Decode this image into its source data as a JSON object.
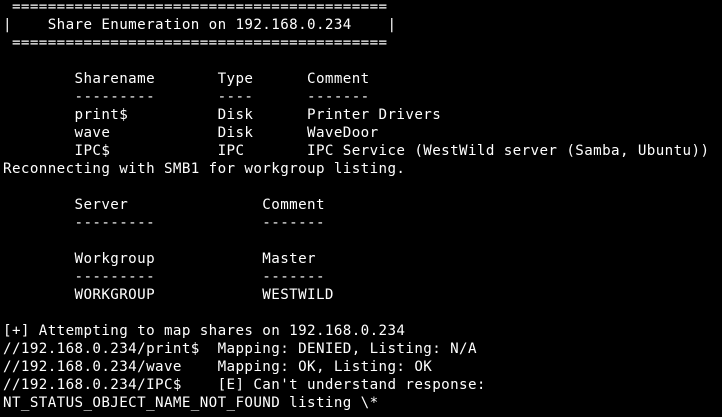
{
  "terminal": {
    "colors": {
      "background": "#000000",
      "foreground": "#ffffff"
    },
    "lines": [
      " ==========================================",
      "|    Share Enumeration on 192.168.0.234    |",
      " ==========================================",
      "",
      "        Sharename       Type      Comment",
      "        ---------       ----      -------",
      "        print$          Disk      Printer Drivers",
      "        wave            Disk      WaveDoor",
      "        IPC$            IPC       IPC Service (WestWild server (Samba, Ubuntu))",
      "Reconnecting with SMB1 for workgroup listing.",
      "",
      "        Server               Comment",
      "        ---------            -------",
      "",
      "        Workgroup            Master",
      "        ---------            -------",
      "        WORKGROUP            WESTWILD",
      "",
      "[+] Attempting to map shares on 192.168.0.234",
      "//192.168.0.234/print$  Mapping: DENIED, Listing: N/A",
      "//192.168.0.234/wave    Mapping: OK, Listing: OK",
      "//192.168.0.234/IPC$    [E] Can't understand response:",
      "NT_STATUS_OBJECT_NAME_NOT_FOUND listing \\*"
    ]
  }
}
